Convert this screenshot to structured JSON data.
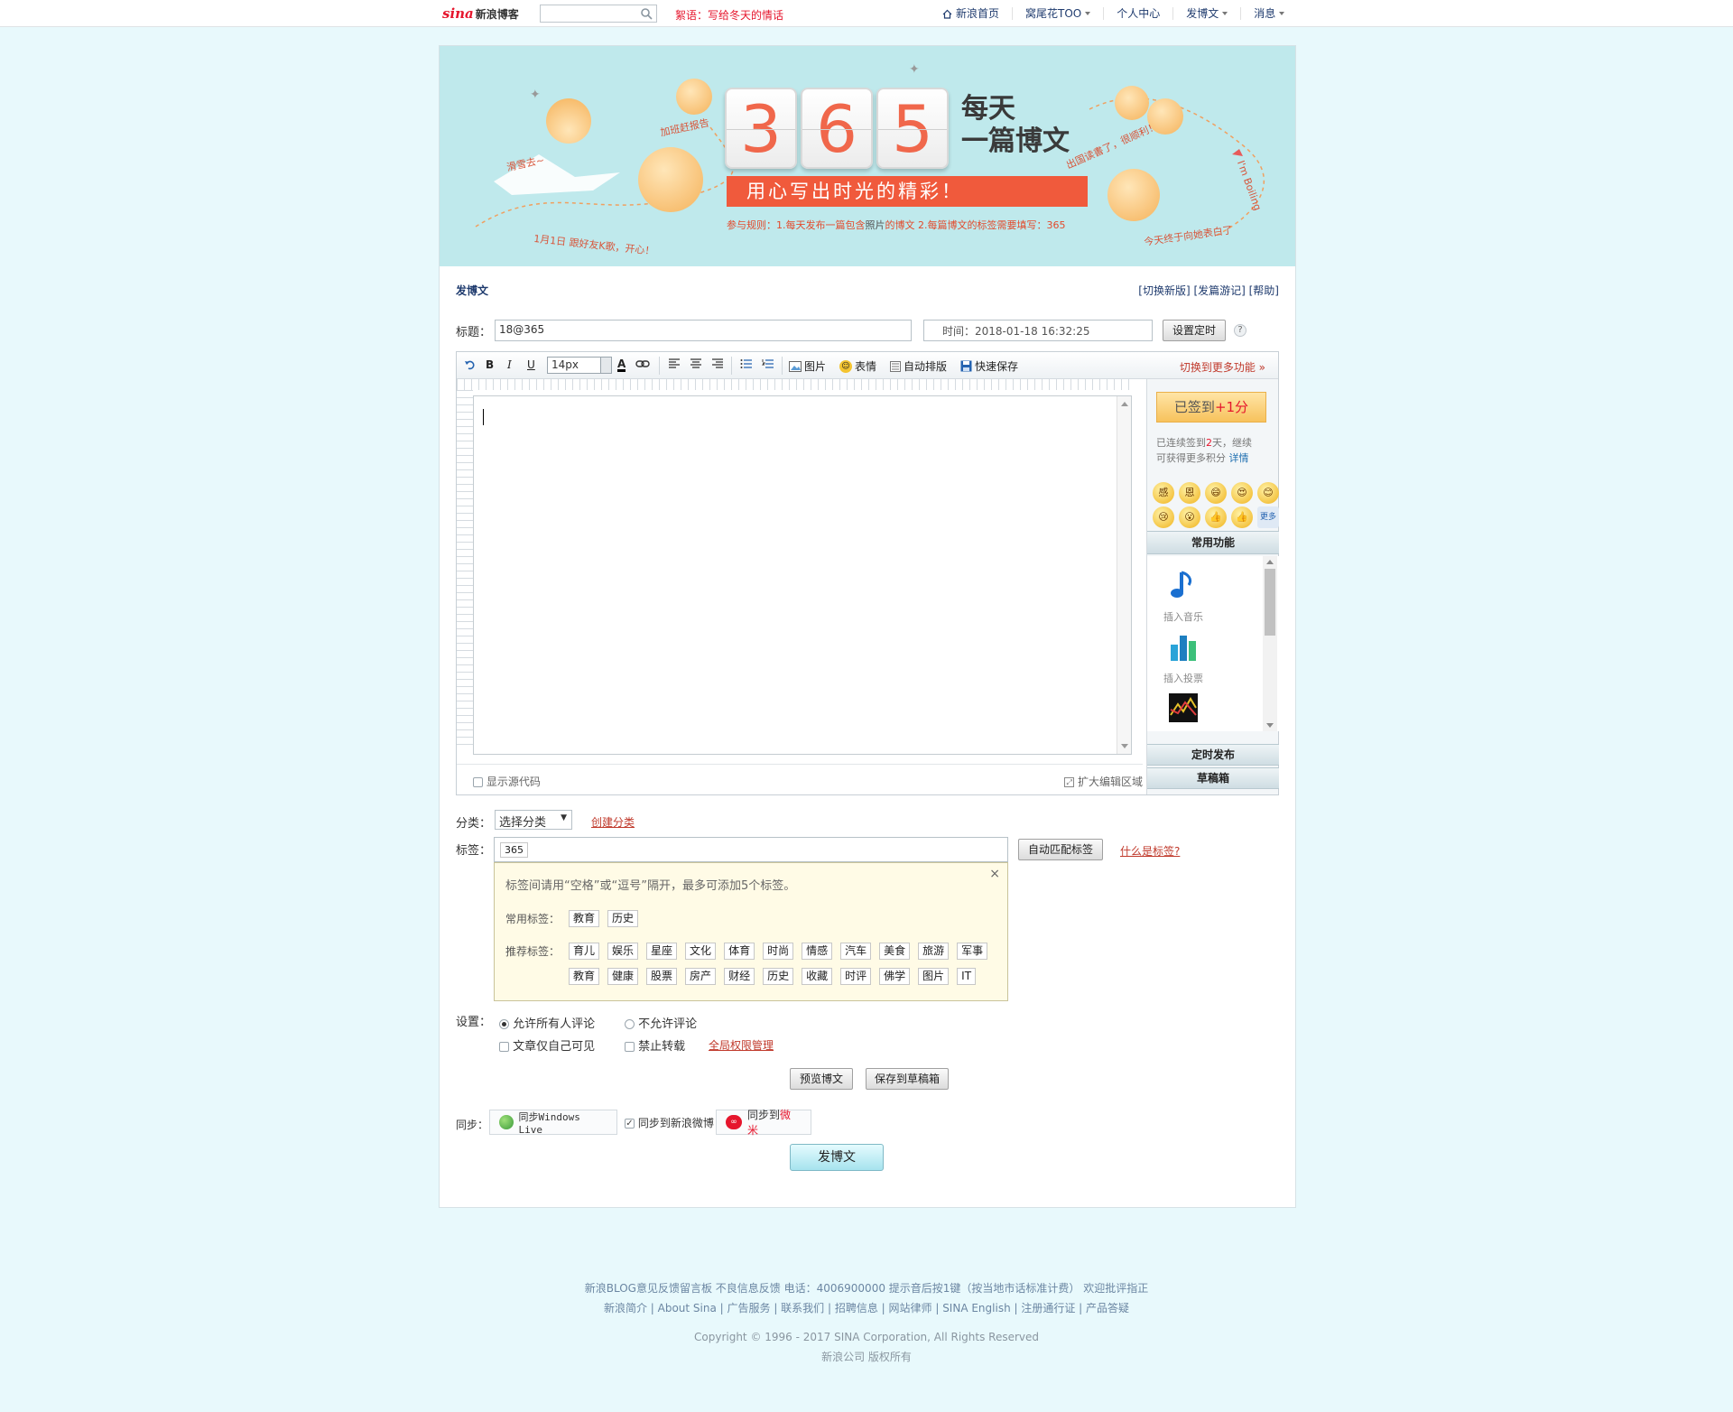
{
  "topbar": {
    "logo_sina": "sina",
    "logo_blog": "新浪博客",
    "notice": "絮语：写给冬天的情话",
    "nav": [
      {
        "label": "新浪首页",
        "icon": "home-icon"
      },
      {
        "label": "窝尾花TOO",
        "dropdown": true
      },
      {
        "label": "个人中心"
      },
      {
        "label": "发博文",
        "dropdown": true
      },
      {
        "label": "消息",
        "dropdown": true
      }
    ]
  },
  "banner": {
    "digits": [
      "3",
      "6",
      "5"
    ],
    "title_line1": "每天",
    "title_line2": "一篇博文",
    "slogan": "用心写出时光的精彩！",
    "rule_prefix": "参与规则：1.每天发布一篇包含",
    "rule_mid": "照片",
    "rule_suffix": "的博文 2.每篇博文的标签需要填写：365",
    "doodles": [
      "滑雪去~",
      "加班赶报告",
      "1月1日 跟好友K歌，开心！",
      "出国读書了，很顺利！",
      "今天终于向她表白了",
      "I'm Boiling"
    ]
  },
  "form": {
    "section_title": "发博文",
    "links": "[切换新版] [发篇游记]  [帮助]",
    "title_label": "标题：",
    "title_value": "18@365",
    "time_label": "时间：",
    "time_value": "2018-01-18 16:32:25",
    "schedule_btn": "设置定时",
    "help": "?"
  },
  "toolbar": {
    "font_size": "14px",
    "image": "图片",
    "emotion": "表情",
    "auto_layout": "自动排版",
    "quick_save": "快速保存",
    "more": "切换到更多功能"
  },
  "editor": {
    "show_source": "显示源代码",
    "expand": "扩大编辑区域"
  },
  "side": {
    "signed_prefix": "已签到",
    "signed_bonus": "+1分",
    "streak_a": "已连续签到",
    "streak_days": "2",
    "streak_b": "天，继续",
    "streak_c": "可获得更多积分",
    "detail": "详情",
    "emojis": [
      "感",
      "恩",
      "😄",
      "😍",
      "😊",
      "😢",
      "😮",
      "👍",
      "👍",
      "更多"
    ],
    "common_head": "常用功能",
    "tools": [
      {
        "label": "插入音乐",
        "icon": "music-note-icon"
      },
      {
        "label": "插入投票",
        "icon": "bar-chart-icon"
      },
      {
        "label": "",
        "icon": "stock-chart-icon"
      }
    ],
    "scheduled": "定时发布",
    "drafts": "草稿箱"
  },
  "category": {
    "label": "分类：",
    "select": "选择分类",
    "create": "创建分类"
  },
  "tags": {
    "label": "标签：",
    "value": "365",
    "auto_btn": "自动匹配标签",
    "what": "什么是标签?",
    "hint": "标签间请用“空格”或“逗号”隔开，最多可添加5个标签。",
    "close": "×",
    "common_label": "常用标签：",
    "common": [
      "教育",
      "历史"
    ],
    "rec_label": "推荐标签：",
    "rec_row1": [
      "育儿",
      "娱乐",
      "星座",
      "文化",
      "体育",
      "时尚",
      "情感",
      "汽车",
      "美食",
      "旅游",
      "军事"
    ],
    "rec_row2": [
      "教育",
      "健康",
      "股票",
      "房产",
      "财经",
      "历史",
      "收藏",
      "时评",
      "佛学",
      "图片",
      "IT"
    ]
  },
  "settings": {
    "label": "设置：",
    "allow_all": "允许所有人评论",
    "disallow": "不允许评论",
    "only_me": "文章仅自己可见",
    "no_repost": "禁止转载",
    "global_perm": "全局权限管理"
  },
  "actions": {
    "preview": "预览博文",
    "save_draft": "保存到草稿箱",
    "sync_label": "同步：",
    "sync_live": "同步Windows Live",
    "sync_weibo": "同步到新浪微博",
    "sync_weimi_prefix": "同步到",
    "sync_weimi": "微米",
    "publish": "发博文"
  },
  "footer": {
    "line1": "新浪BLOG意见反馈留言板   不良信息反馈   电话：4006900000 提示音后按1键（按当地市话标准计费）   欢迎批评指正",
    "line2": "新浪简介 | About Sina | 广告服务 | 联系我们 | 招聘信息 | 网站律师 | SINA English | 注册通行证 | 产品答疑",
    "copyright": "Copyright © 1996 - 2017 SINA Corporation, All Rights Reserved",
    "company": "新浪公司 版权所有"
  },
  "colors": {
    "brand_red": "#e6162d",
    "banner_bg": "#bfe9ec",
    "page_bg": "#e8f9fc",
    "digit": "#f0674b"
  }
}
